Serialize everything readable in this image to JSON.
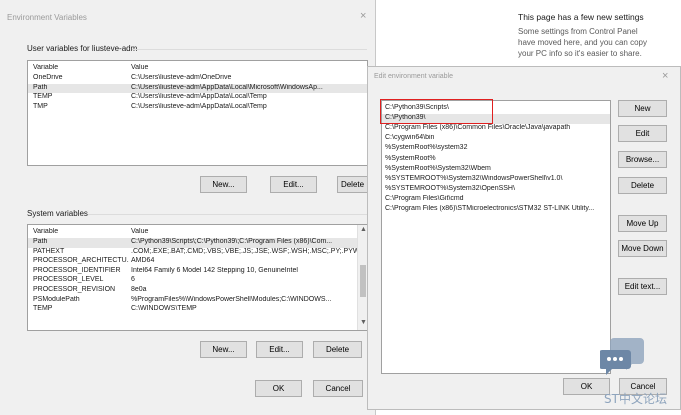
{
  "bg_panel": {
    "heading": "This page has a few new settings",
    "line1": "Some settings from Control Panel",
    "line2": "have moved here, and you can copy",
    "line3": "your PC info so it's easier to share."
  },
  "env_dialog": {
    "title": "Environment Variables",
    "user_group_label": "User variables for liusteve-adm",
    "user_columns": [
      "Variable",
      "Value"
    ],
    "user_rows": [
      {
        "variable": "OneDrive",
        "value": "C:\\Users\\liusteve-adm\\OneDrive"
      },
      {
        "variable": "Path",
        "value": "C:\\Users\\liusteve-adm\\AppData\\Local\\Microsoft\\WindowsAp..."
      },
      {
        "variable": "TEMP",
        "value": "C:\\Users\\liusteve-adm\\AppData\\Local\\Temp"
      },
      {
        "variable": "TMP",
        "value": "C:\\Users\\liusteve-adm\\AppData\\Local\\Temp"
      }
    ],
    "user_buttons": {
      "new": "New...",
      "edit": "Edit...",
      "delete": "Delete"
    },
    "system_group_label": "System variables",
    "system_columns": [
      "Variable",
      "Value"
    ],
    "system_rows": [
      {
        "variable": "Path",
        "value": "C:\\Python39\\Scripts\\;C:\\Python39\\;C:\\Program Files (x86)\\Com..."
      },
      {
        "variable": "PATHEXT",
        "value": ".COM;.EXE;.BAT;.CMD;.VBS;.VBE;.JS;.JSE;.WSF;.WSH;.MSC;.PY;.PYW"
      },
      {
        "variable": "PROCESSOR_ARCHITECTU...",
        "value": "AMD64"
      },
      {
        "variable": "PROCESSOR_IDENTIFIER",
        "value": "Intel64 Family 6 Model 142 Stepping 10, GenuineIntel"
      },
      {
        "variable": "PROCESSOR_LEVEL",
        "value": "6"
      },
      {
        "variable": "PROCESSOR_REVISION",
        "value": "8e0a"
      },
      {
        "variable": "PSModulePath",
        "value": "%ProgramFiles%\\WindowsPowerShell\\Modules;C:\\WINDOWS..."
      },
      {
        "variable": "TEMP",
        "value": "C:\\WINDOWS\\TEMP"
      }
    ],
    "system_buttons": {
      "new": "New...",
      "edit": "Edit...",
      "delete": "Delete"
    },
    "ok": "OK",
    "cancel": "Cancel",
    "close_glyph": "×"
  },
  "edit_dialog": {
    "title": "Edit environment variable",
    "close_glyph": "×",
    "paths": [
      "C:\\Python39\\Scripts\\",
      "C:\\Python39\\",
      "C:\\Program Files (x86)\\Common Files\\Oracle\\Java\\javapath",
      "C:\\cygwin64\\bin",
      "%SystemRoot%\\system32",
      "%SystemRoot%",
      "%SystemRoot%\\System32\\Wbem",
      "%SYSTEMROOT%\\System32\\WindowsPowerShell\\v1.0\\",
      "%SYSTEMROOT%\\System32\\OpenSSH\\",
      "C:\\Program Files\\Git\\cmd",
      "C:\\Program Files (x86)\\STMicroelectronics\\STM32 ST-LINK Utility..."
    ],
    "buttons": {
      "new": "New",
      "edit": "Edit",
      "browse": "Browse...",
      "delete": "Delete",
      "move_up": "Move Up",
      "move_down": "Move Down",
      "edit_text": "Edit text..."
    },
    "ok": "OK",
    "cancel": "Cancel",
    "highlight_color": "#e02020"
  },
  "watermark": {
    "text": "ST中文论坛",
    "color": "#8ea4bd"
  }
}
